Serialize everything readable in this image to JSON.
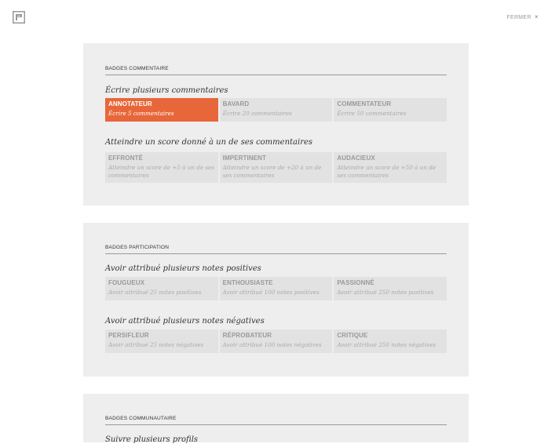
{
  "header": {
    "close_label": "FERMER",
    "close_icon": "×"
  },
  "sections": [
    {
      "title": "BADGES COMMENTAIRE",
      "groups": [
        {
          "title": "Écrire plusieurs commentaires",
          "badges": [
            {
              "name": "ANNOTATEUR",
              "desc": "Écrire 5 commentaires",
              "earned": true
            },
            {
              "name": "BAVARD",
              "desc": "Écrire 20 commentaires",
              "earned": false
            },
            {
              "name": "COMMENTATEUR",
              "desc": "Écrire 50 commentaires",
              "earned": false
            }
          ]
        },
        {
          "title": "Atteindre un score donné à un de ses commentaires",
          "badges": [
            {
              "name": "EFFRONTÉ",
              "desc": "Atteindre un score de +5 à un de ses commentaires",
              "earned": false
            },
            {
              "name": "IMPERTINENT",
              "desc": "Atteindre un score de +20 à un de ses commentaires",
              "earned": false
            },
            {
              "name": "AUDACIEUX",
              "desc": "Atteindre un score de +50 à un de ses commentaires",
              "earned": false
            }
          ]
        }
      ]
    },
    {
      "title": "BADGES PARTICIPATION",
      "groups": [
        {
          "title": "Avoir attribué plusieurs notes positives",
          "badges": [
            {
              "name": "FOUGUEUX",
              "desc": "Avoir attribué 25 notes positives",
              "earned": false
            },
            {
              "name": "ENTHOUSIASTE",
              "desc": "Avoir attribué 100 notes positives",
              "earned": false
            },
            {
              "name": "PASSIONNÉ",
              "desc": "Avoir attribué 250 notes positives",
              "earned": false
            }
          ]
        },
        {
          "title": "Avoir attribué plusieurs notes négatives",
          "badges": [
            {
              "name": "PERSIFLEUR",
              "desc": "Avoir attribué 25 notes négatives",
              "earned": false
            },
            {
              "name": "RÉPROBATEUR",
              "desc": "Avoir attribué 100 notes négatives",
              "earned": false
            },
            {
              "name": "CRITIQUE",
              "desc": "Avoir attribué 250 notes négatives",
              "earned": false
            }
          ]
        }
      ]
    },
    {
      "title": "BADGES COMMUNAUTAIRE",
      "groups": [
        {
          "title": "Suivre plusieurs profils",
          "badges": []
        }
      ]
    }
  ],
  "colors": {
    "accent": "#e8673a",
    "panel": "#eeeeee",
    "badge": "#e2e2e2"
  }
}
